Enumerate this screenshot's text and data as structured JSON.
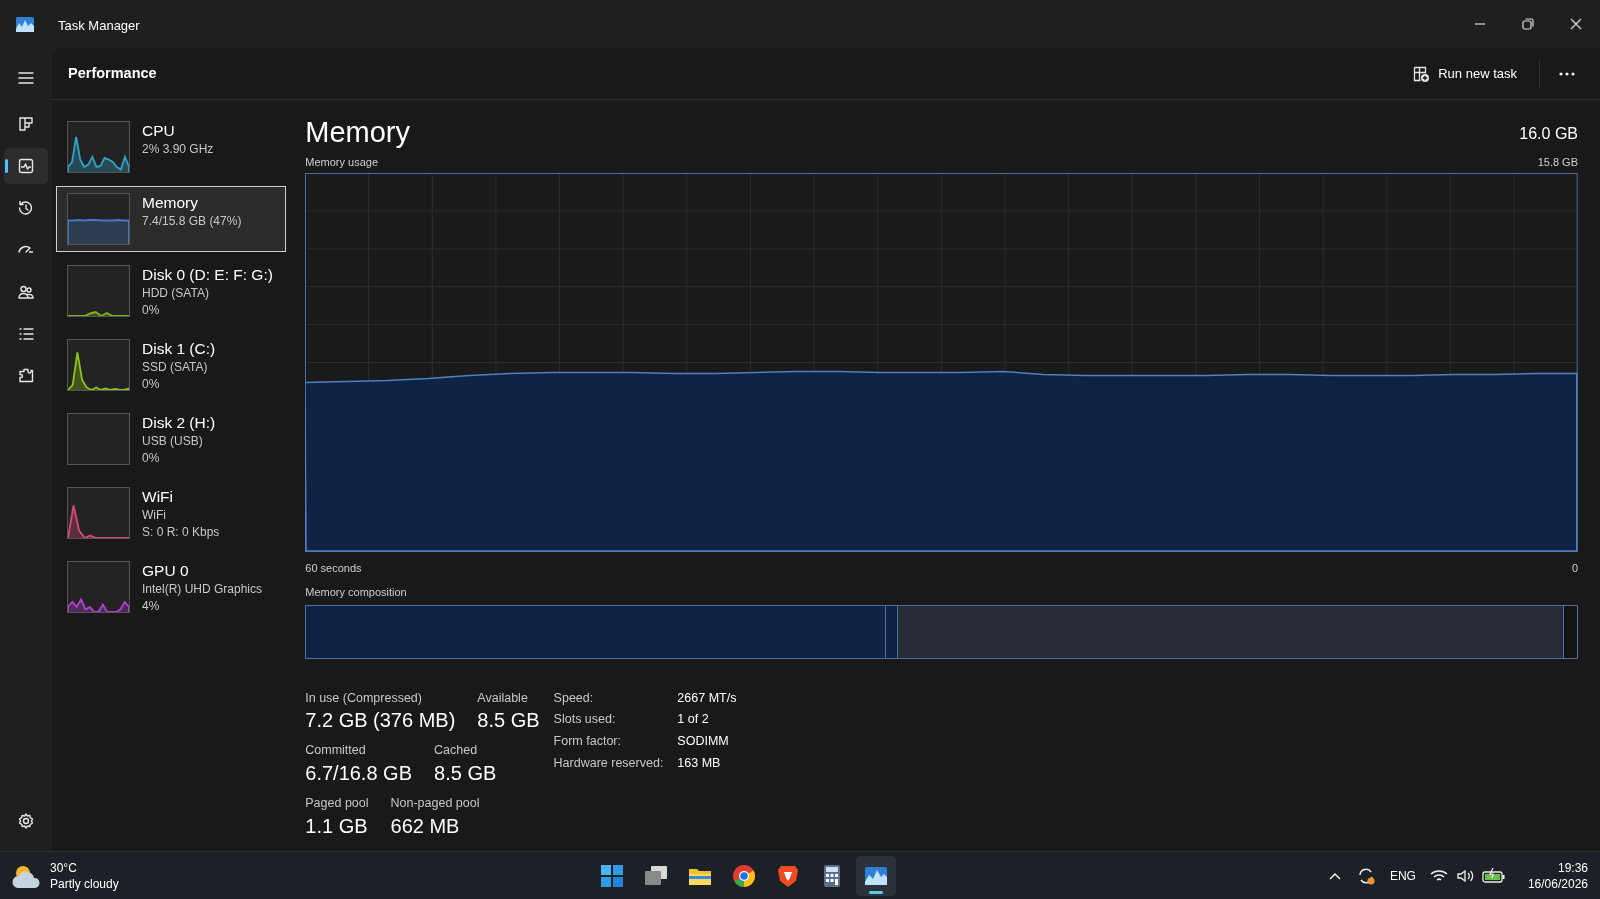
{
  "window": {
    "title": "Task Manager"
  },
  "nav": [
    {
      "kind": "menu",
      "selected": false
    },
    {
      "kind": "processes",
      "selected": false
    },
    {
      "kind": "performance",
      "selected": true
    },
    {
      "kind": "history",
      "selected": false
    },
    {
      "kind": "startup",
      "selected": false
    },
    {
      "kind": "users",
      "selected": false
    },
    {
      "kind": "details",
      "selected": false
    },
    {
      "kind": "services",
      "selected": false
    }
  ],
  "nav_bottom": {
    "kind": "settings"
  },
  "header": {
    "title": "Performance",
    "run_new_task": "Run new task"
  },
  "devices": [
    {
      "name": "CPU",
      "lines": [
        "2% 3.90 GHz"
      ],
      "color": "#2fa3c4",
      "selected": false
    },
    {
      "name": "Memory",
      "lines": [
        "7.4/15.8 GB (47%)"
      ],
      "color": "#4a78c0",
      "selected": true
    },
    {
      "name": "Disk 0 (D: E: F: G:)",
      "lines": [
        "HDD (SATA)",
        "0%"
      ],
      "color": "#7cb518",
      "selected": false
    },
    {
      "name": "Disk 1 (C:)",
      "lines": [
        "SSD (SATA)",
        "0%"
      ],
      "color": "#8cc21a",
      "selected": false
    },
    {
      "name": "Disk 2 (H:)",
      "lines": [
        "USB (USB)",
        "0%"
      ],
      "selected": false
    },
    {
      "name": "WiFi",
      "lines": [
        "WiFi",
        "S: 0 R: 0 Kbps"
      ],
      "color": "#d9487a",
      "selected": false
    },
    {
      "name": "GPU 0",
      "lines": [
        "Intel(R) UHD Graphics",
        "4%"
      ],
      "color": "#b040d0",
      "selected": false
    }
  ],
  "main": {
    "title": "Memory",
    "total": "16.0 GB",
    "usage_label": "Memory usage",
    "usage_max": "15.8 GB",
    "x_start": "60 seconds",
    "x_end": "0",
    "composition_label": "Memory composition",
    "composition": [
      {
        "kind": "in_use",
        "level": 0.456
      },
      {
        "kind": "modified",
        "level": 0.466
      },
      {
        "kind": "standby",
        "level": 0.99
      }
    ],
    "stats": [
      [
        {
          "label": "In use (Compressed)",
          "value": "7.2 GB (376 MB)"
        },
        {
          "label": "Available",
          "value": "8.5 GB"
        }
      ],
      [
        {
          "label": "Committed",
          "value": "6.7/16.8 GB"
        },
        {
          "label": "Cached",
          "value": "8.5 GB"
        }
      ],
      [
        {
          "label": "Paged pool",
          "value": "1.1 GB"
        },
        {
          "label": "Non-paged pool",
          "value": "662 MB"
        }
      ]
    ],
    "properties": [
      {
        "label": "Speed:",
        "value": "2667 MT/s"
      },
      {
        "label": "Slots used:",
        "value": "1 of 2"
      },
      {
        "label": "Form factor:",
        "value": "SODIMM"
      },
      {
        "label": "Hardware reserved:",
        "value": "163 MB"
      }
    ]
  },
  "taskbar": {
    "weather": {
      "temperature": "30°C",
      "condition": "Partly cloudy"
    },
    "apps": [
      {
        "kind": "start",
        "active": false
      },
      {
        "kind": "taskview",
        "active": false
      },
      {
        "kind": "folder",
        "active": false
      },
      {
        "kind": "chrome",
        "active": false
      },
      {
        "kind": "shield",
        "active": false
      },
      {
        "kind": "calculator",
        "active": false
      },
      {
        "kind": "taskmanager",
        "active": true
      }
    ],
    "language": "ENG",
    "time": "19:36",
    "date": "16/06/2026"
  }
}
